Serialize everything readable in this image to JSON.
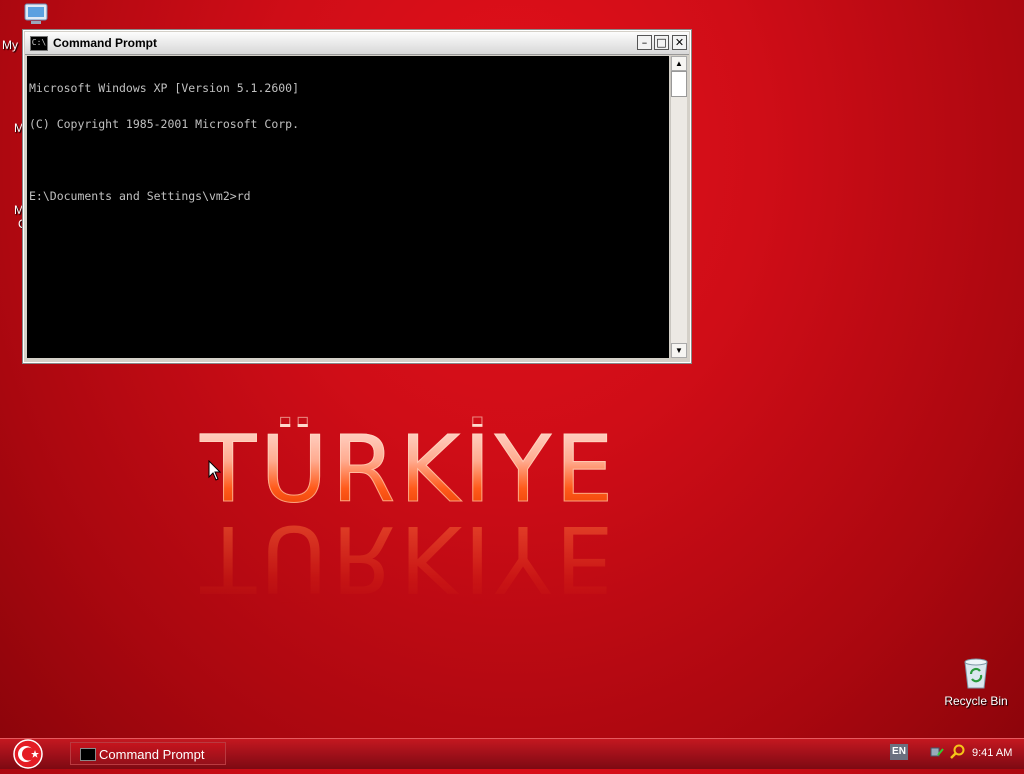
{
  "desktop": {
    "icons": {
      "my_computer_partial_label": "My",
      "partial_label_2": "M",
      "partial_label_3a": "M",
      "partial_label_3b": "C",
      "recycle_bin_label": "Recycle Bin"
    },
    "wallpaper_text": "TÜRKİYE"
  },
  "cmd_window": {
    "title": "Command Prompt",
    "icon_text": "C:\\",
    "console_lines": [
      "Microsoft Windows XP [Version 5.1.2600]",
      "(C) Copyright 1985-2001 Microsoft Corp.",
      "",
      "E:\\Documents and Settings\\vm2>rd"
    ],
    "minimize": "–",
    "maximize": "□",
    "close": "✕"
  },
  "taskbar": {
    "task_label": "Command Prompt",
    "language": "EN",
    "clock": "9:41 AM"
  },
  "colors": {
    "desktop_red": "#d0101a",
    "taskbar_red": "#a0101a",
    "console_bg": "#000000",
    "console_fg": "#c0c0c0"
  }
}
